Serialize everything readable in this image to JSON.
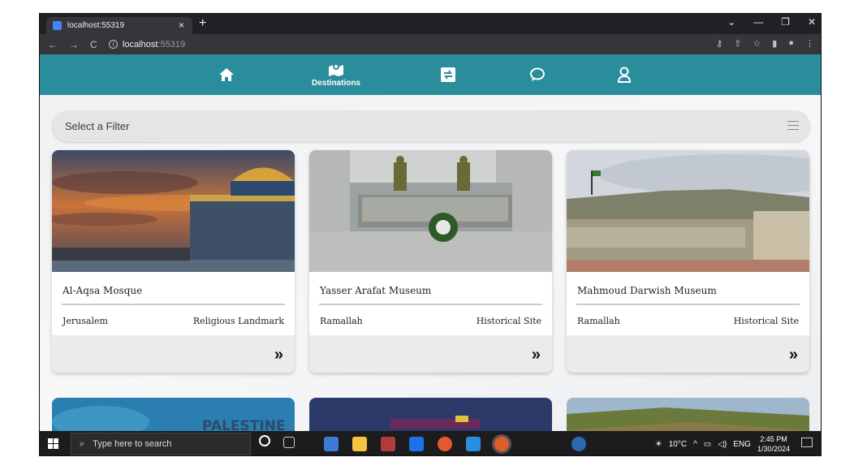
{
  "browser": {
    "tab_title": "localhost:55319",
    "tab_close": "×",
    "new_tab": "+",
    "url_host": "localhost",
    "url_port": ":55319",
    "window_controls": [
      "⌄",
      "—",
      "❐",
      "✕"
    ]
  },
  "nav": {
    "items": [
      {
        "name": "home",
        "label": ""
      },
      {
        "name": "destinations",
        "label": "Destinations"
      },
      {
        "name": "exchange",
        "label": ""
      },
      {
        "name": "chat",
        "label": ""
      },
      {
        "name": "profile",
        "label": ""
      }
    ],
    "color": "#2a8d9b"
  },
  "filter": {
    "placeholder": "Select a Filter"
  },
  "cards": [
    {
      "title": "Al-Aqsa Mosque",
      "city": "Jerusalem",
      "type": "Religious Landmark",
      "action": "»"
    },
    {
      "title": "Yasser Arafat Museum",
      "city": "Ramallah",
      "type": "Historical Site",
      "action": "»"
    },
    {
      "title": "Mahmoud Darwish Museum",
      "city": "Ramallah",
      "type": "Historical Site",
      "action": "»"
    }
  ],
  "partial_cards": [
    {
      "overlay_text": "PALESTINE"
    },
    {
      "overlay_text": ""
    },
    {
      "overlay_text": ""
    }
  ],
  "taskbar": {
    "search_placeholder": "Type here to search",
    "weather": "10°C",
    "lang": "ENG",
    "time": "2:45 PM",
    "date": "1/30/2024"
  }
}
